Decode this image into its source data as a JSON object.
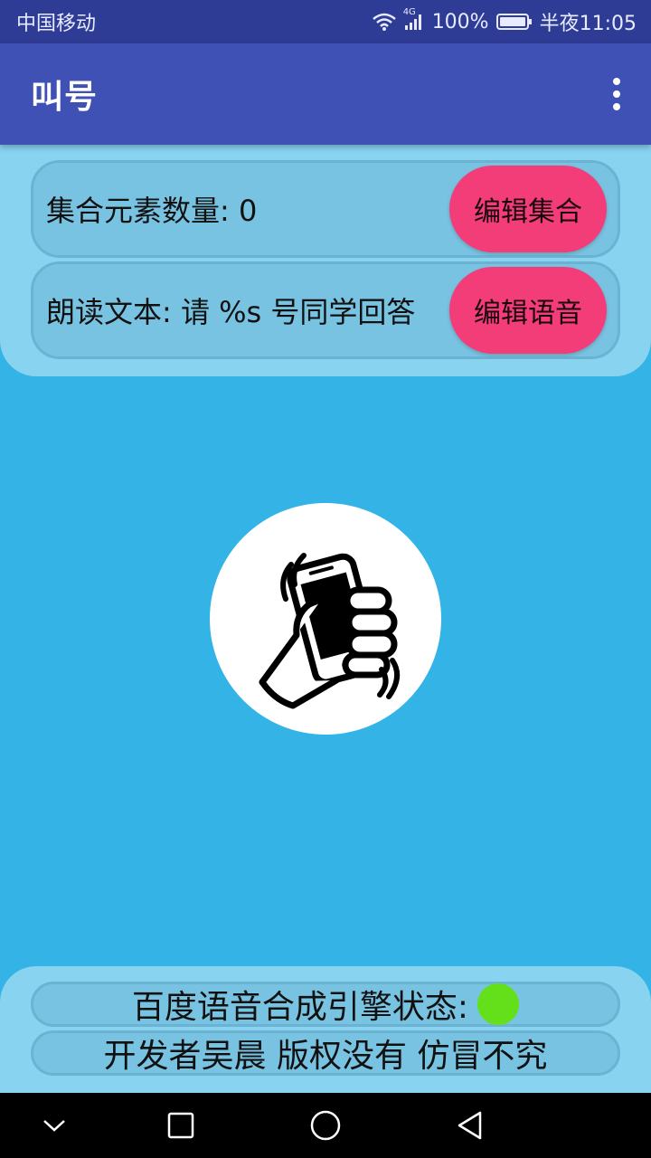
{
  "status_bar": {
    "carrier": "中国移动",
    "network": "4G",
    "battery": "100%",
    "time": "半夜11:05"
  },
  "app_bar": {
    "title": "叫号",
    "overflow_icon": "more-vert-icon"
  },
  "set_panel": {
    "count_label": "集合元素数量: 0",
    "edit_set_button": "编辑集合",
    "speech_text_label": "朗读文本: 请 %s 号同学回答",
    "edit_speech_button": "编辑语音"
  },
  "call_button": {
    "icon": "shaking-phone-hand-icon"
  },
  "footer": {
    "engine_status_label": "百度语音合成引擎状态:",
    "engine_status_color": "#63e01a",
    "credits": "开发者吴晨 版权没有 仿冒不究"
  },
  "nav_bar": {
    "icons": [
      "collapse-icon",
      "recents-icon",
      "home-icon",
      "back-icon"
    ]
  },
  "colors": {
    "status_bar": "#2f3c96",
    "app_bar": "#3f51b5",
    "background": "#33b3e6",
    "panel": "#87d3f0",
    "accent_button": "#f23d78"
  }
}
